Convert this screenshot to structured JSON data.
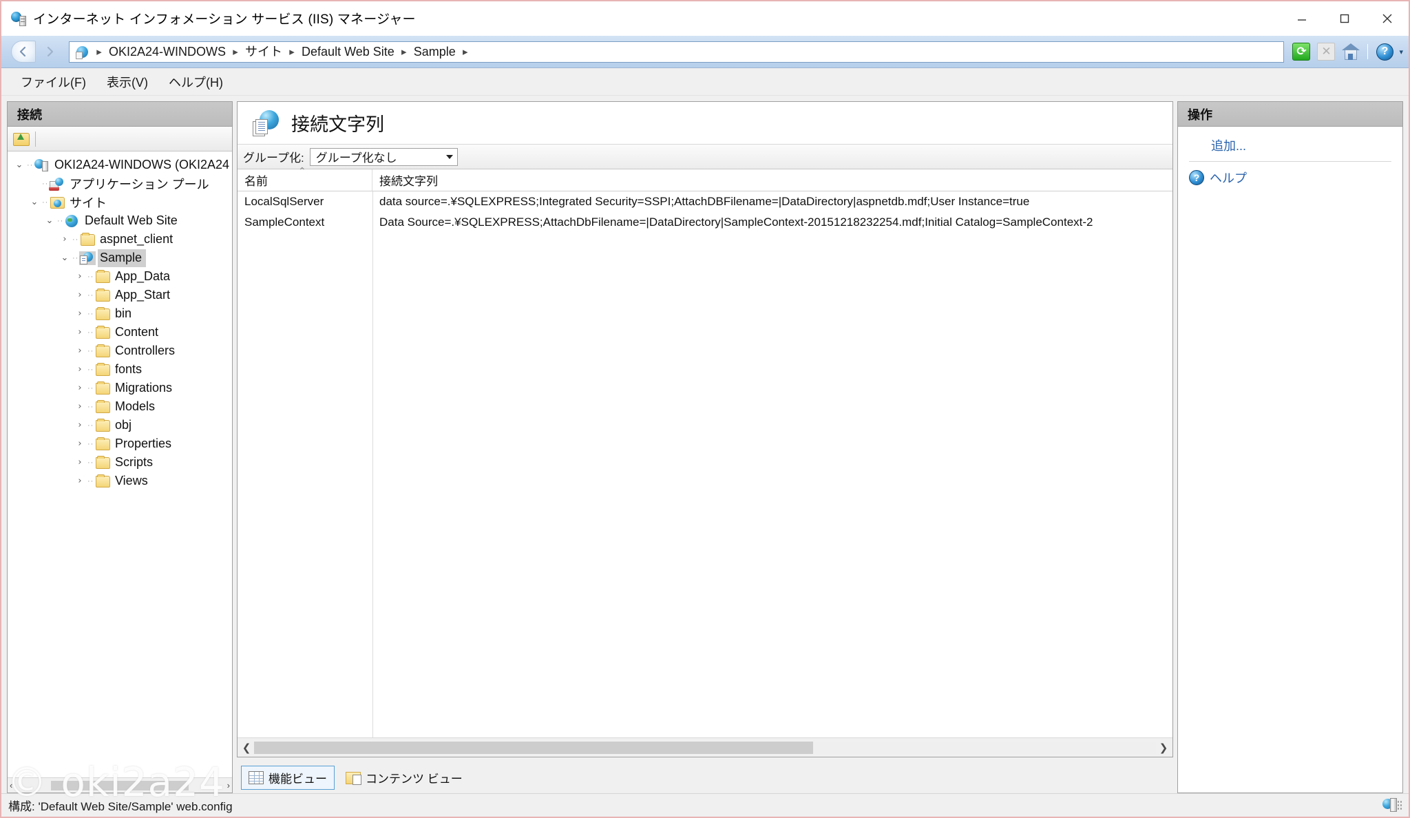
{
  "window": {
    "title": "インターネット インフォメーション サービス (IIS) マネージャー",
    "title_icon": "iis-server-icon",
    "controls": {
      "minimize": "minimize-icon",
      "maximize": "maximize-icon",
      "close": "close-icon"
    }
  },
  "addressbar": {
    "back_icon": "back-arrow-icon",
    "forward_icon": "forward-arrow-icon",
    "home_icon": "site-globe-icon",
    "breadcrumbs": [
      "OKI2A24-WINDOWS",
      "サイト",
      "Default Web Site",
      "Sample"
    ],
    "separator": "▸",
    "tools": [
      {
        "name": "refresh-icon",
        "glyph": "⟳"
      },
      {
        "name": "stop-icon",
        "glyph": "✕"
      },
      {
        "name": "home-icon",
        "glyph": ""
      },
      {
        "name": "help-icon",
        "glyph": "?"
      },
      {
        "name": "help-dropdown-icon",
        "glyph": "▾"
      }
    ]
  },
  "menubar": {
    "items": [
      {
        "label": "ファイル(F)"
      },
      {
        "label": "表示(V)"
      },
      {
        "label": "ヘルプ(H)"
      }
    ]
  },
  "connections": {
    "header": "接続",
    "toolbar_icon": "connect-to-server-icon",
    "tree": [
      {
        "label": "OKI2A24-WINDOWS (OKI2A24",
        "depth": 0,
        "twist": "⌄",
        "icon": "server-icon",
        "selected": false
      },
      {
        "label": "アプリケーション プール",
        "depth": 1,
        "twist": "",
        "icon": "app-pools-icon",
        "selected": false
      },
      {
        "label": "サイト",
        "depth": 1,
        "twist": "⌄",
        "icon": "sites-folder-icon",
        "selected": false
      },
      {
        "label": "Default Web Site",
        "depth": 2,
        "twist": "⌄",
        "icon": "website-icon",
        "selected": false
      },
      {
        "label": "aspnet_client",
        "depth": 3,
        "twist": "›",
        "icon": "folder-icon",
        "selected": false
      },
      {
        "label": "Sample",
        "depth": 3,
        "twist": "⌄",
        "icon": "application-icon",
        "selected": true
      },
      {
        "label": "App_Data",
        "depth": 4,
        "twist": "›",
        "icon": "folder-icon",
        "selected": false
      },
      {
        "label": "App_Start",
        "depth": 4,
        "twist": "›",
        "icon": "folder-icon",
        "selected": false
      },
      {
        "label": "bin",
        "depth": 4,
        "twist": "›",
        "icon": "folder-icon",
        "selected": false
      },
      {
        "label": "Content",
        "depth": 4,
        "twist": "›",
        "icon": "folder-icon",
        "selected": false
      },
      {
        "label": "Controllers",
        "depth": 4,
        "twist": "›",
        "icon": "folder-icon",
        "selected": false
      },
      {
        "label": "fonts",
        "depth": 4,
        "twist": "›",
        "icon": "folder-icon",
        "selected": false
      },
      {
        "label": "Migrations",
        "depth": 4,
        "twist": "›",
        "icon": "folder-icon",
        "selected": false
      },
      {
        "label": "Models",
        "depth": 4,
        "twist": "›",
        "icon": "folder-icon",
        "selected": false
      },
      {
        "label": "obj",
        "depth": 4,
        "twist": "›",
        "icon": "folder-icon",
        "selected": false
      },
      {
        "label": "Properties",
        "depth": 4,
        "twist": "›",
        "icon": "folder-icon",
        "selected": false
      },
      {
        "label": "Scripts",
        "depth": 4,
        "twist": "›",
        "icon": "folder-icon",
        "selected": false
      },
      {
        "label": "Views",
        "depth": 4,
        "twist": "›",
        "icon": "folder-icon",
        "selected": false
      }
    ],
    "hscroll": {
      "left_arrow": "‹",
      "right_arrow": "›"
    }
  },
  "feature": {
    "icon": "connection-strings-icon",
    "title": "接続文字列",
    "group_label": "グループ化:",
    "group_value": "グループ化なし",
    "columns": [
      {
        "key": "name",
        "label": "名前",
        "sorted": true,
        "sort_glyph": "⌃"
      },
      {
        "key": "connection_string",
        "label": "接続文字列",
        "sorted": false
      }
    ],
    "rows": [
      {
        "name": "LocalSqlServer",
        "connection_string": "data source=.¥SQLEXPRESS;Integrated Security=SSPI;AttachDBFilename=|DataDirectory|aspnetdb.mdf;User Instance=true"
      },
      {
        "name": "SampleContext",
        "connection_string": "Data Source=.¥SQLEXPRESS;AttachDbFilename=|DataDirectory|SampleContext-20151218232254.mdf;Initial Catalog=SampleContext-2"
      }
    ],
    "hscroll": {
      "left_arrow": "❮",
      "right_arrow": "❯",
      "thumb_percent": 62
    }
  },
  "view_tabs": [
    {
      "label": "機能ビュー",
      "icon": "features-view-icon",
      "active": true
    },
    {
      "label": "コンテンツ ビュー",
      "icon": "content-view-icon",
      "active": false
    }
  ],
  "actions": {
    "header": "操作",
    "items": [
      {
        "label": "追加...",
        "icon": "",
        "indent": true
      },
      {
        "label": "ヘルプ",
        "icon": "help-icon",
        "indent": false
      }
    ]
  },
  "statusbar": {
    "text": "構成: 'Default Web Site/Sample' web.config",
    "icon": "ready-server-icon"
  },
  "watermark": {
    "text": "© oki2a24"
  },
  "colors": {
    "accent_link": "#2a63ad",
    "panel_header": "#c8c8c8",
    "address_bar": "#c3d7ef",
    "selection": "#cfcfcf",
    "window_border": "#e8b4b4"
  }
}
